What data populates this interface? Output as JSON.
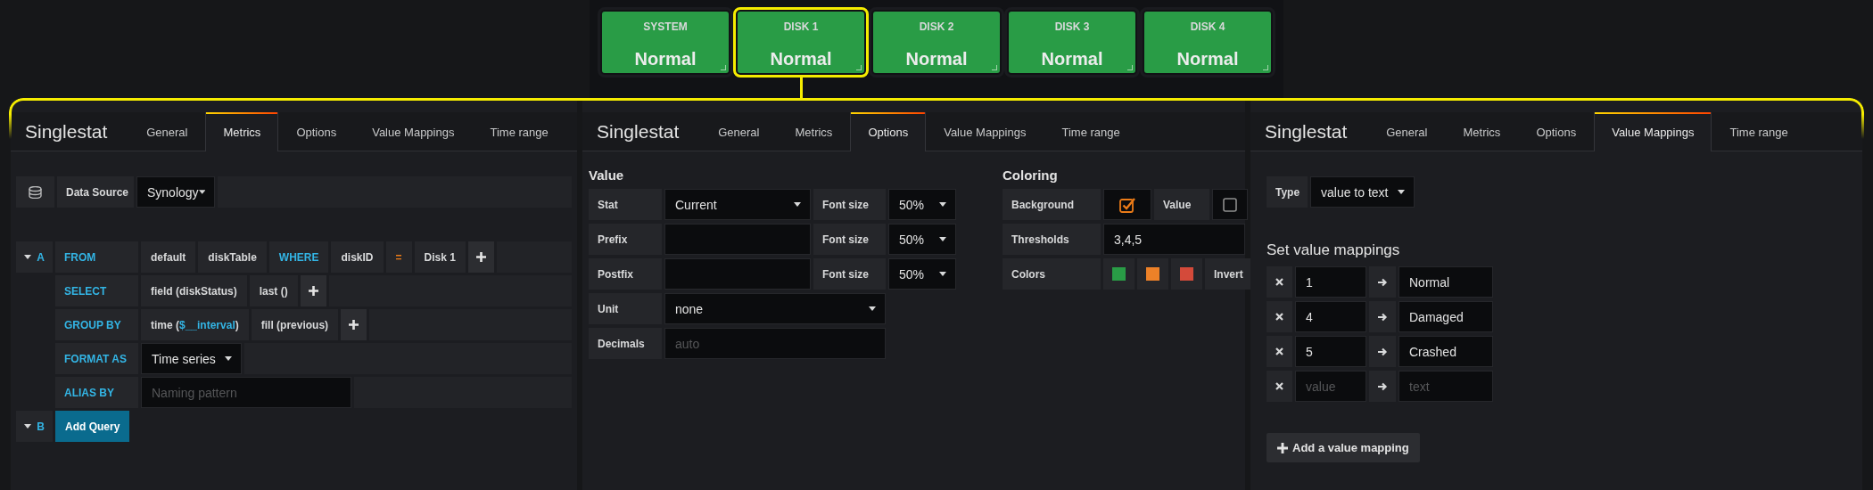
{
  "tiles": [
    {
      "label": "SYSTEM",
      "value": "Normal",
      "selected": false
    },
    {
      "label": "DISK 1",
      "value": "Normal",
      "selected": true
    },
    {
      "label": "DISK 2",
      "value": "Normal",
      "selected": false
    },
    {
      "label": "DISK 3",
      "value": "Normal",
      "selected": false
    },
    {
      "label": "DISK 4",
      "value": "Normal",
      "selected": false
    }
  ],
  "panels": [
    {
      "kind": "metrics",
      "title": "Singlestat",
      "tabs": [
        {
          "label": "General",
          "selected": false
        },
        {
          "label": "Metrics",
          "selected": true
        },
        {
          "label": "Options",
          "selected": false
        },
        {
          "label": "Value Mappings",
          "selected": false
        },
        {
          "label": "Time range",
          "selected": false
        }
      ],
      "data_source": {
        "label": "Data Source",
        "value": "Synology"
      },
      "queries": [
        {
          "ref": "A",
          "rows": [
            {
              "keyword": "FROM",
              "kind": "segments",
              "parts": [
                {
                  "kind": "segment",
                  "text": "default"
                },
                {
                  "kind": "segment",
                  "text": "diskTable"
                },
                {
                  "kind": "keyword",
                  "text": "WHERE"
                },
                {
                  "kind": "segment",
                  "text": "diskID"
                },
                {
                  "kind": "operator",
                  "text": "="
                },
                {
                  "kind": "segment",
                  "text": "Disk 1"
                },
                {
                  "kind": "add"
                }
              ]
            },
            {
              "keyword": "SELECT",
              "kind": "segments",
              "parts": [
                {
                  "kind": "segment",
                  "text": "field (diskStatus)"
                },
                {
                  "kind": "segment",
                  "text": "last ()"
                },
                {
                  "kind": "add"
                }
              ]
            },
            {
              "keyword": "GROUP BY",
              "kind": "segments",
              "parts": [
                {
                  "kind": "segment",
                  "spans": [
                    {
                      "text": "time ("
                    },
                    {
                      "text": "$__interval",
                      "kind": "variable"
                    },
                    {
                      "text": ")"
                    }
                  ]
                },
                {
                  "kind": "segment",
                  "text": "fill (previous)"
                },
                {
                  "kind": "add"
                }
              ]
            },
            {
              "keyword": "FORMAT AS",
              "kind": "select",
              "value": "Time series"
            },
            {
              "keyword": "ALIAS BY",
              "kind": "input",
              "placeholder": "Naming pattern"
            }
          ]
        },
        {
          "ref": "B",
          "button": "Add Query"
        }
      ]
    },
    {
      "kind": "options",
      "title": "Singlestat",
      "tabs": [
        {
          "label": "General",
          "selected": false
        },
        {
          "label": "Metrics",
          "selected": false
        },
        {
          "label": "Options",
          "selected": true
        },
        {
          "label": "Value Mappings",
          "selected": false
        },
        {
          "label": "Time range",
          "selected": false
        }
      ],
      "value_section": {
        "heading": "Value",
        "rows": [
          {
            "label": "Stat",
            "kind": "select",
            "value": "Current",
            "font_size": {
              "label": "Font size",
              "value": "50%"
            }
          },
          {
            "label": "Prefix",
            "kind": "input",
            "font_size": {
              "label": "Font size",
              "value": "50%"
            }
          },
          {
            "label": "Postfix",
            "kind": "input",
            "font_size": {
              "label": "Font size",
              "value": "50%"
            }
          },
          {
            "label": "Unit",
            "kind": "select",
            "value": "none"
          },
          {
            "label": "Decimals",
            "kind": "input",
            "placeholder": "auto"
          }
        ]
      },
      "coloring": {
        "heading": "Coloring",
        "checks": [
          {
            "label": "Background",
            "checked": true
          },
          {
            "label": "Value",
            "checked": false
          }
        ],
        "thresholds": {
          "label": "Thresholds",
          "value": "3,4,5"
        },
        "colors": {
          "label": "Colors",
          "swatches": [
            {
              "color": "#299c46"
            },
            {
              "color": "#ed8128"
            },
            {
              "color": "#d44a3a"
            }
          ],
          "invert": "Invert"
        }
      }
    },
    {
      "kind": "mappings",
      "title": "Singlestat",
      "tabs": [
        {
          "label": "General",
          "selected": false
        },
        {
          "label": "Metrics",
          "selected": false
        },
        {
          "label": "Options",
          "selected": false
        },
        {
          "label": "Value Mappings",
          "selected": true
        },
        {
          "label": "Time range",
          "selected": false
        }
      ],
      "type": {
        "label": "Type",
        "value": "value to text"
      },
      "heading": "Set value mappings",
      "mappings": [
        {
          "value": "1",
          "text": "Normal"
        },
        {
          "value": "4",
          "text": "Damaged"
        },
        {
          "value": "5",
          "text": "Crashed"
        },
        {
          "value_placeholder": "value",
          "text_placeholder": "text"
        }
      ],
      "add_button": "Add a value mapping"
    }
  ]
}
